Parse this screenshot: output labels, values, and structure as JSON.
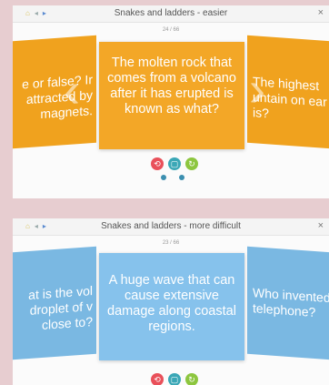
{
  "easier": {
    "title": "Snakes and ladders - easier",
    "counter": "24 / 66",
    "left_card": "e or false? Ir attracted by magnets.",
    "main_card": "The molten rock that comes from a volcano after it has erupted is known as what?",
    "right_card": "The highest untain on ear is?",
    "colors": {
      "card": "#f0a21e"
    }
  },
  "difficult": {
    "title": "Snakes and ladders - more difficult",
    "counter": "23 / 66",
    "left_card": "at is the vol droplet of v close to?",
    "main_card": "A huge wave that can cause extensive damage along coastal regions.",
    "right_card": "Who invented telephone?",
    "colors": {
      "card": "#7ab8e2"
    }
  },
  "controls": {
    "retry_icon": "retry-icon",
    "tile_icon": "tile-icon",
    "refresh_icon": "refresh-icon",
    "colors": {
      "red": "#e9505a",
      "teal": "#3aa7b6",
      "green": "#8dc63f"
    }
  },
  "window": {
    "close_label": "×"
  }
}
